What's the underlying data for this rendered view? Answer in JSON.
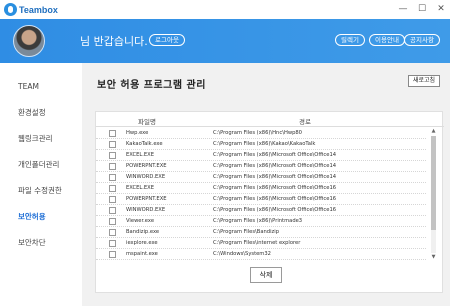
{
  "titlebar": {
    "app_name": "Teambox",
    "logo_icon": "teambox-logo-icon",
    "minimize": "—",
    "maximize": "☐",
    "close": "✕"
  },
  "header": {
    "greeting": "님 반갑습니다.",
    "logout_label": "로그아웃",
    "manual_label": "릴렉기",
    "usage_label": "이용안내",
    "notice_label": "공지사항",
    "colors": {
      "header_bg": "#2f8de4"
    }
  },
  "sidebar": {
    "items": [
      {
        "label": "TEAM",
        "active": false
      },
      {
        "label": "환경설정",
        "active": false
      },
      {
        "label": "웹링크관리",
        "active": false
      },
      {
        "label": "개인폴더관리",
        "active": false
      },
      {
        "label": "파일 수정권한",
        "active": false
      },
      {
        "label": "보안허용",
        "active": true
      },
      {
        "label": "보안차단",
        "active": false
      }
    ],
    "active_color": "#1f6fd6"
  },
  "main": {
    "title": "보안 허용 프로그램 관리",
    "refresh_label": "새로고침",
    "table": {
      "columns": [
        "파일명",
        "경로"
      ],
      "rows": [
        {
          "name": "Hwp.exe",
          "path": "C:\\Program Files (x86)\\Hnc\\Hwp80"
        },
        {
          "name": "KakaoTalk.exe",
          "path": "C:\\Program Files (x86)\\Kakao\\KakaoTalk"
        },
        {
          "name": "EXCEL.EXE",
          "path": "C:\\Program Files (x86)\\Microsoft Office\\Office14"
        },
        {
          "name": "POWERPNT.EXE",
          "path": "C:\\Program Files (x86)\\Microsoft Office\\Office14"
        },
        {
          "name": "WINWORD.EXE",
          "path": "C:\\Program Files (x86)\\Microsoft Office\\Office14"
        },
        {
          "name": "EXCEL.EXE",
          "path": "C:\\Program Files (x86)\\Microsoft Office\\Office16"
        },
        {
          "name": "POWERPNT.EXE",
          "path": "C:\\Program Files (x86)\\Microsoft Office\\Office16"
        },
        {
          "name": "WINWORD.EXE",
          "path": "C:\\Program Files (x86)\\Microsoft Office\\Office16"
        },
        {
          "name": "Viewer.exe",
          "path": "C:\\Program Files (x86)\\Printmade3"
        },
        {
          "name": "Bandizip.exe",
          "path": "C:\\Program Files\\Bandizip"
        },
        {
          "name": "iexplore.exe",
          "path": "C:\\Program Files\\internet explorer"
        },
        {
          "name": "mspaint.exe",
          "path": "C:\\Windows\\System32"
        }
      ]
    },
    "delete_label": "삭제"
  }
}
